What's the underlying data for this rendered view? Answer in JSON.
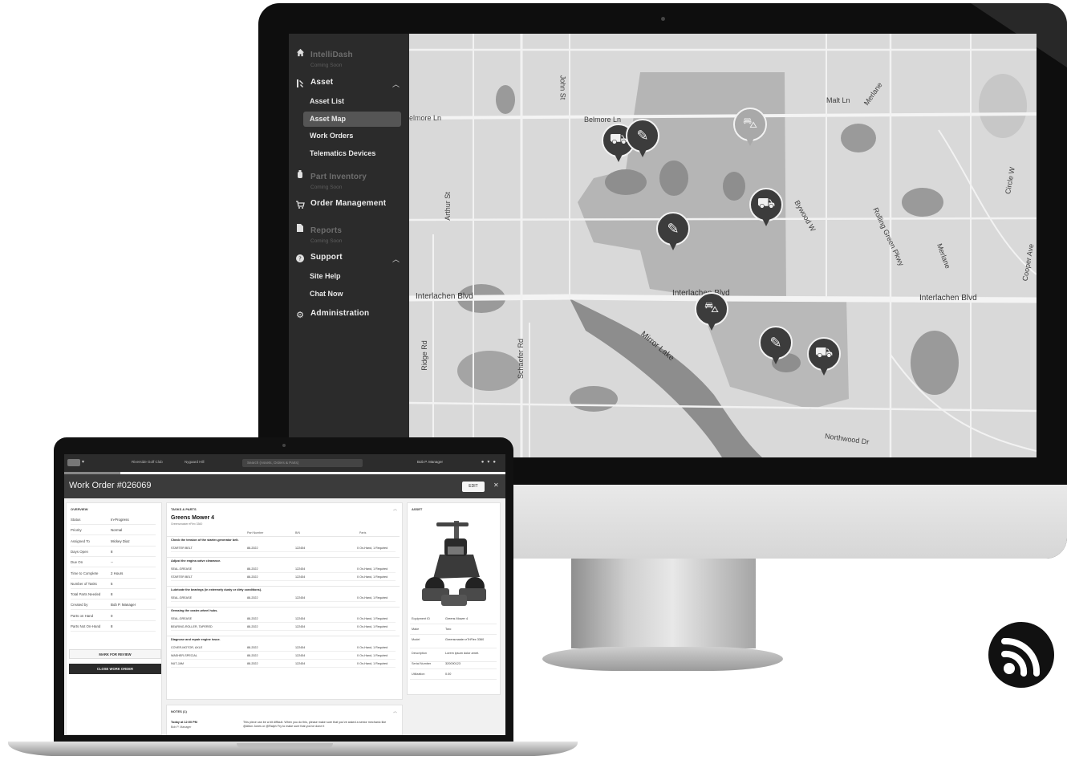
{
  "monitor": {
    "sidebar": {
      "intellidash": {
        "label": "IntelliDash",
        "sub": "Coming Soon"
      },
      "asset": {
        "label": "Asset",
        "children": [
          "Asset List",
          "Asset Map",
          "Work Orders",
          "Telematics Devices"
        ]
      },
      "part_inventory": {
        "label": "Part Inventory",
        "sub": "Coming Soon"
      },
      "order_management": {
        "label": "Order Management"
      },
      "reports": {
        "label": "Reports",
        "sub": "Coming Soon"
      },
      "support": {
        "label": "Support",
        "children": [
          "Site Help",
          "Chat Now"
        ]
      },
      "administration": {
        "label": "Administration"
      },
      "icons": [
        "home-icon",
        "tools-icon",
        "oil-can-icon",
        "cart-icon",
        "file-icon",
        "chat-bubble-icon",
        "gear-icon"
      ]
    },
    "map": {
      "streets": {
        "belmore_ln_left": "elmore Ln",
        "belmore_ln": "Belmore Ln",
        "john_st": "John St",
        "malt_ln": "Malt Ln",
        "merlane_top": "Merlane",
        "circle_w": "Circle W",
        "arthur_st": "Arthur St",
        "bywood_w": "Bywood W",
        "rolling_green": "Rolling Green Pkwy",
        "merlane_right": "Merlane",
        "cooper_ave": "Cooper Ave",
        "interlachen_left": "Interlachen Blvd",
        "interlachen_mid": "Interlachen Blvd",
        "interlachen_right": "Interlachen Blvd",
        "ridge_rd": "Ridge Rd",
        "schaefer_rd": "Schaefer Rd",
        "mirror_lake": "Mirror Lake",
        "northwood_dr": "Northwood Dr"
      },
      "pins": [
        "riding-mower-icon",
        "spreader-icon",
        "utility-cart-icon",
        "blower-icon",
        "trimmer-icon",
        "mower-icon",
        "trimmer-icon",
        "riding-mower-icon"
      ]
    }
  },
  "laptop": {
    "topbar": {
      "chip1": "Riverside Golf Club",
      "chip2": "Nygaard Hill",
      "search_placeholder": "Search (Assets, Orders & Parts)",
      "user": "Bob P. Manager"
    },
    "title": "Work Order #026069",
    "edit_label": "EDIT",
    "overview": {
      "heading": "OVERVIEW",
      "rows": [
        {
          "k": "Status",
          "v": "In-Progress"
        },
        {
          "k": "Priority",
          "v": "Normal"
        },
        {
          "k": "Assigned To",
          "v": "Mickey Diaz"
        },
        {
          "k": "Days Open",
          "v": "8"
        },
        {
          "k": "Due On",
          "v": "--"
        },
        {
          "k": "Time to Complete",
          "v": "2 Hours"
        },
        {
          "k": "Number of Tasks",
          "v": "5"
        },
        {
          "k": "Total Parts Needed",
          "v": "8"
        },
        {
          "k": "Created by",
          "v": "Bob P. Manager"
        },
        {
          "k": "Parts on Hand",
          "v": "0"
        },
        {
          "k": "Parts Not On-Hand",
          "v": "8"
        }
      ],
      "review_button": "MARK FOR REVIEW",
      "close_button": "CLOSE WORK ORDER"
    },
    "tasks": {
      "heading": "TASKS & PARTS",
      "asset_title": "Greens Mower 4",
      "asset_sub": "Greensmaster eFlex 3360",
      "columns": [
        "Part Number",
        "B/N",
        "Parts"
      ],
      "groups": [
        {
          "task": "Check the tension of the starter-generator belt.",
          "parts": [
            [
              "STARTER BELT",
              "88-2022",
              "122454",
              "0 On-Hand, 1 Required"
            ]
          ]
        },
        {
          "task": "Adjust the engine-valve clearance.",
          "parts": [
            [
              "SEAL-GREASE",
              "88-2022",
              "122454",
              "0 On-Hand, 1 Required"
            ],
            [
              "STARTER BELT",
              "88-2022",
              "122454",
              "0 On-Hand, 1 Required"
            ]
          ]
        },
        {
          "task": "Lubricate the bearings (in extremely dusty or dirty conditions).",
          "parts": [
            [
              "SEAL-GREASE",
              "88-2022",
              "122454",
              "0 On-Hand, 1 Required"
            ]
          ]
        },
        {
          "task": "Greasing the caster-wheel hubs.",
          "parts": [
            [
              "SEAL-GREASE",
              "88-2022",
              "122454",
              "0 On-Hand, 1 Required"
            ],
            [
              "BEARING-ROLLER, TAPERED",
              "88-2022",
              "122454",
              "0 On-Hand, 1 Required"
            ]
          ]
        },
        {
          "task": "Diagnose and repair engine issue.",
          "parts": [
            [
              "COVER-MOTOR, AXLE",
              "88-2022",
              "122454",
              "0 On-Hand, 1 Required"
            ],
            [
              "WASHER-SPECIAL",
              "88-2022",
              "122454",
              "0 On-Hand, 1 Required"
            ],
            [
              "NUT-JAM",
              "88-2022",
              "122454",
              "0 On-Hand, 1 Required"
            ]
          ]
        }
      ]
    },
    "notes": {
      "heading": "NOTES (1)",
      "time": "Today at 12:00 PM",
      "author": "Bob P. Manager",
      "text": "This piece can be a bit difficult. When you do this, please make sure that you've asked a senior mechanic like @Alton Jones or @Ralph Fry to make sure that you've done it"
    },
    "asset": {
      "heading": "ASSET",
      "rows": [
        {
          "k": "Equipment ID",
          "v": "Greens Mower 4"
        },
        {
          "k": "Make",
          "v": "Toro"
        },
        {
          "k": "Model",
          "v": "Greensmaster eTriFlex 3360"
        },
        {
          "k": "Description",
          "v": "Lorem ipsum dolor amet."
        },
        {
          "k": "Serial Number",
          "v": "320000123"
        },
        {
          "k": "Utilization",
          "v": "0.00"
        }
      ]
    }
  },
  "badge_icon": "wireless-signal-icon"
}
